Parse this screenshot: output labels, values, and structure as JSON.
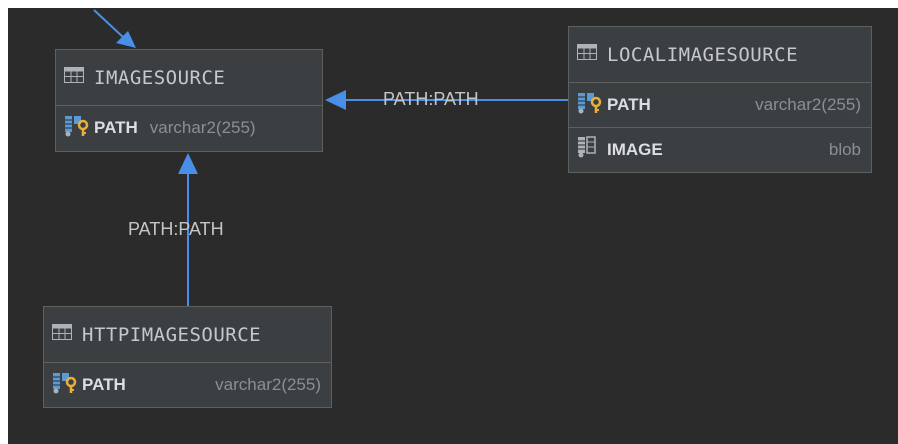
{
  "tables": {
    "imagesource": {
      "name": "IMAGESOURCE",
      "columns": [
        {
          "name": "PATH",
          "type": "varchar2(255)",
          "icon": "primary-key-column-icon"
        }
      ]
    },
    "localimagesource": {
      "name": "LOCALIMAGESOURCE",
      "columns": [
        {
          "name": "PATH",
          "type": "varchar2(255)",
          "icon": "primary-key-column-icon"
        },
        {
          "name": "IMAGE",
          "type": "blob",
          "icon": "column-icon"
        }
      ]
    },
    "httpimagesource": {
      "name": "HTTPIMAGESOURCE",
      "columns": [
        {
          "name": "PATH",
          "type": "varchar2(255)",
          "icon": "primary-key-column-icon"
        }
      ]
    }
  },
  "relations": {
    "local_to_image": {
      "label": "PATH:PATH"
    },
    "http_to_image": {
      "label": "PATH:PATH"
    }
  },
  "colors": {
    "canvas": "#2b2b2b",
    "table_bg": "#3c3f41",
    "edge": "#4a8fe7"
  }
}
